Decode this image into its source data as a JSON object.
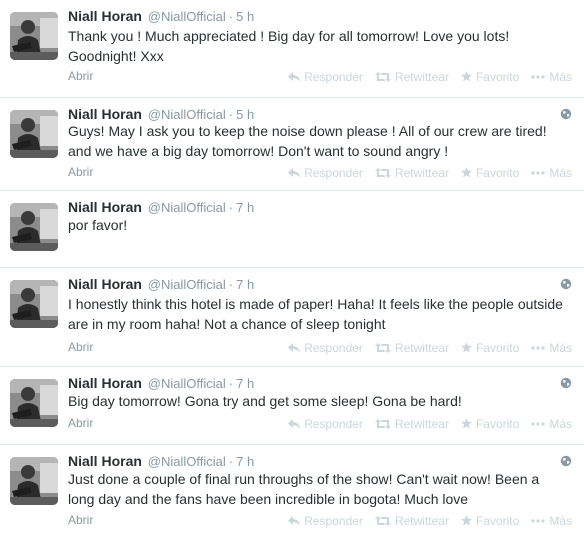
{
  "author": {
    "fullname": "Niall Horan",
    "username": "@NiallOfficial"
  },
  "actions": {
    "expand_label": "Abrir",
    "reply_label": "Responder",
    "retweet_label": "Retwittear",
    "favorite_label": "Favorito",
    "more_label": "Más"
  },
  "icons": {
    "globe": "globe-icon",
    "reply": "reply-icon",
    "retweet": "retweet-icon",
    "favorite": "star-icon",
    "more": "ellipsis-icon"
  },
  "colors": {
    "text": "#292f33",
    "muted": "#8899a6",
    "action": "#ccd6dd",
    "divider": "#e1e8ed"
  },
  "tweets": [
    {
      "time": "5 h",
      "lines": [
        "Thank you ! Much appreciated ! Big day for all tomorrow! Love you lots!",
        "Goodnight! Xxx"
      ],
      "has_footer": true
    },
    {
      "time": "5 h",
      "lines": [
        "Guys! May I ask you to keep the noise down please ! All of our crew are tired!",
        "and we have a big day tomorrow! Don't want to sound angry !"
      ],
      "has_footer": true
    },
    {
      "time": "7 h",
      "lines": [
        "por favor!"
      ],
      "has_footer": false
    },
    {
      "time": "7 h",
      "lines": [
        "I honestly think this hotel is made of paper! Haha! It feels like the people outside",
        "are in my room haha! Not a chance of sleep tonight"
      ],
      "has_footer": true
    },
    {
      "time": "7 h",
      "lines": [
        "Big day tomorrow! Gona try and get some sleep! Gona be hard!"
      ],
      "has_footer": true
    },
    {
      "time": "7 h",
      "lines": [
        "Just done a couple of final run throughs of the show! Can't wait now! Been a",
        "long day and the fans have been incredible in bogota! Much love"
      ],
      "has_footer": true
    }
  ]
}
